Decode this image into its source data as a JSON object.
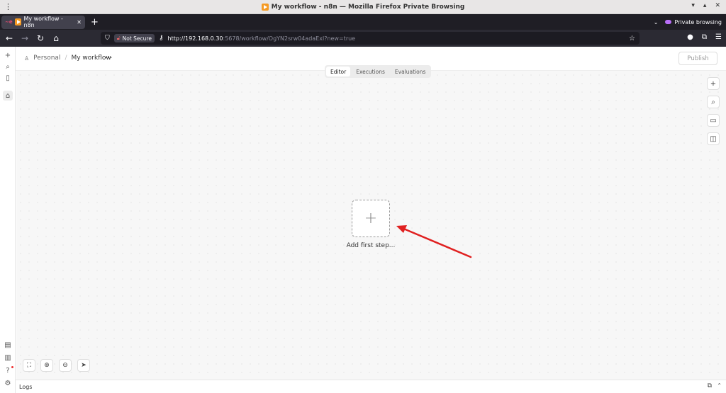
{
  "window": {
    "title": "My workflow - n8n — Mozilla Firefox Private Browsing",
    "controls": [
      "▾",
      "▴",
      "✕"
    ]
  },
  "tabs": [
    {
      "label": "My workflow - n8n",
      "close": "✕",
      "favicon": "n8n-icon"
    }
  ],
  "tabstrip": {
    "new_tab": "+",
    "list_all": "⌄",
    "private_label": "Private browsing"
  },
  "nav": {
    "back": "←",
    "forward": "→",
    "reload": "↻",
    "home": "⌂",
    "security_label": "Not Secure",
    "url_host": "http://192.168.0.30",
    "url_rest": ":5678/workflow/OgYN2srw04adaExl?new=true",
    "bookmark": "☆"
  },
  "rail": {
    "add": "+",
    "search": "⌕",
    "panel": "▯",
    "home": "⌂",
    "templates": "▤",
    "insights": "▥",
    "help": "?",
    "settings": "⚙"
  },
  "header": {
    "project": "Personal",
    "separator": "/",
    "workflow_name": "My workflow",
    "more": "···",
    "publish_label": "Publish"
  },
  "view_tabs": [
    "Editor",
    "Executions",
    "Evaluations"
  ],
  "canvas": {
    "add_first_step_label": "Add first step...",
    "add_symbol": "+",
    "side_controls": [
      "+",
      "⌕",
      "▭",
      "◫"
    ],
    "zoom_controls": [
      "⛶",
      "⊕",
      "⊖",
      "➤"
    ],
    "arrow_color": "#e02020"
  },
  "logs": {
    "label": "Logs"
  }
}
